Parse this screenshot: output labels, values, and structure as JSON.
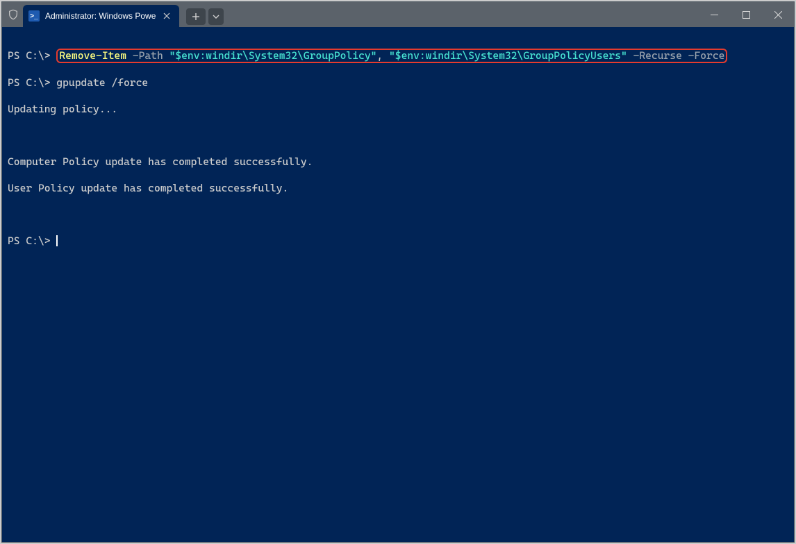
{
  "titlebar": {
    "tab_title": "Administrator: Windows Powe"
  },
  "terminal": {
    "prompt": "PS C:\\>",
    "line1": {
      "cmd": "Remove-Item",
      "param1": "-Path",
      "str1": "\"$env:windir\\System32\\GroupPolicy\"",
      "comma": ",",
      "str2": "\"$env:windir\\System32\\GroupPolicyUsers\"",
      "param2": "-Recurse",
      "param3": "-Force"
    },
    "line2_cmd": "gpupdate /force",
    "line3": "Updating policy...",
    "line4": "Computer Policy update has completed successfully.",
    "line5": "User Policy update has completed successfully."
  }
}
